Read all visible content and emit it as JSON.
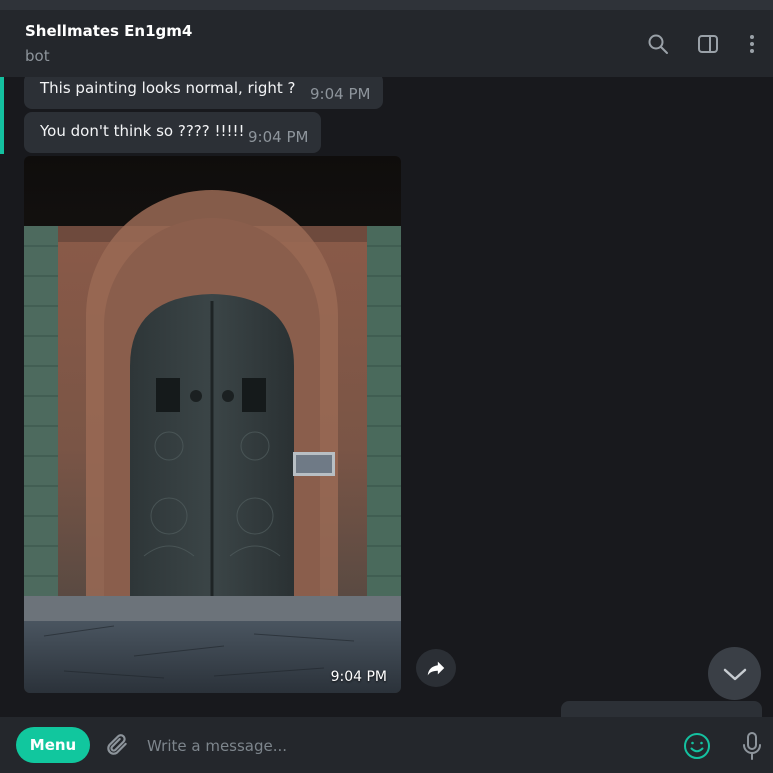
{
  "header": {
    "title": "Shellmates En1gm4",
    "subtitle": "bot",
    "icons": [
      "search-icon",
      "sidebar-toggle-icon",
      "more-vertical-icon"
    ]
  },
  "messages": [
    {
      "text": "This painting looks normal, right ?",
      "time": "9:04 PM"
    },
    {
      "text": "You don't think so ???? !!!!!",
      "time": "9:04 PM"
    }
  ],
  "photo": {
    "time": "9:04 PM",
    "description_icons": [
      "share-icon"
    ]
  },
  "composer": {
    "menu_label": "Menu",
    "placeholder": "Write a message...",
    "icons": [
      "attach-icon",
      "emoji-icon",
      "mic-icon"
    ]
  },
  "colors": {
    "accent": "#14c1a0",
    "menu_button": "#11c79e",
    "bubble": "#2c3036",
    "header": "#24272c",
    "background": "#18191d"
  }
}
